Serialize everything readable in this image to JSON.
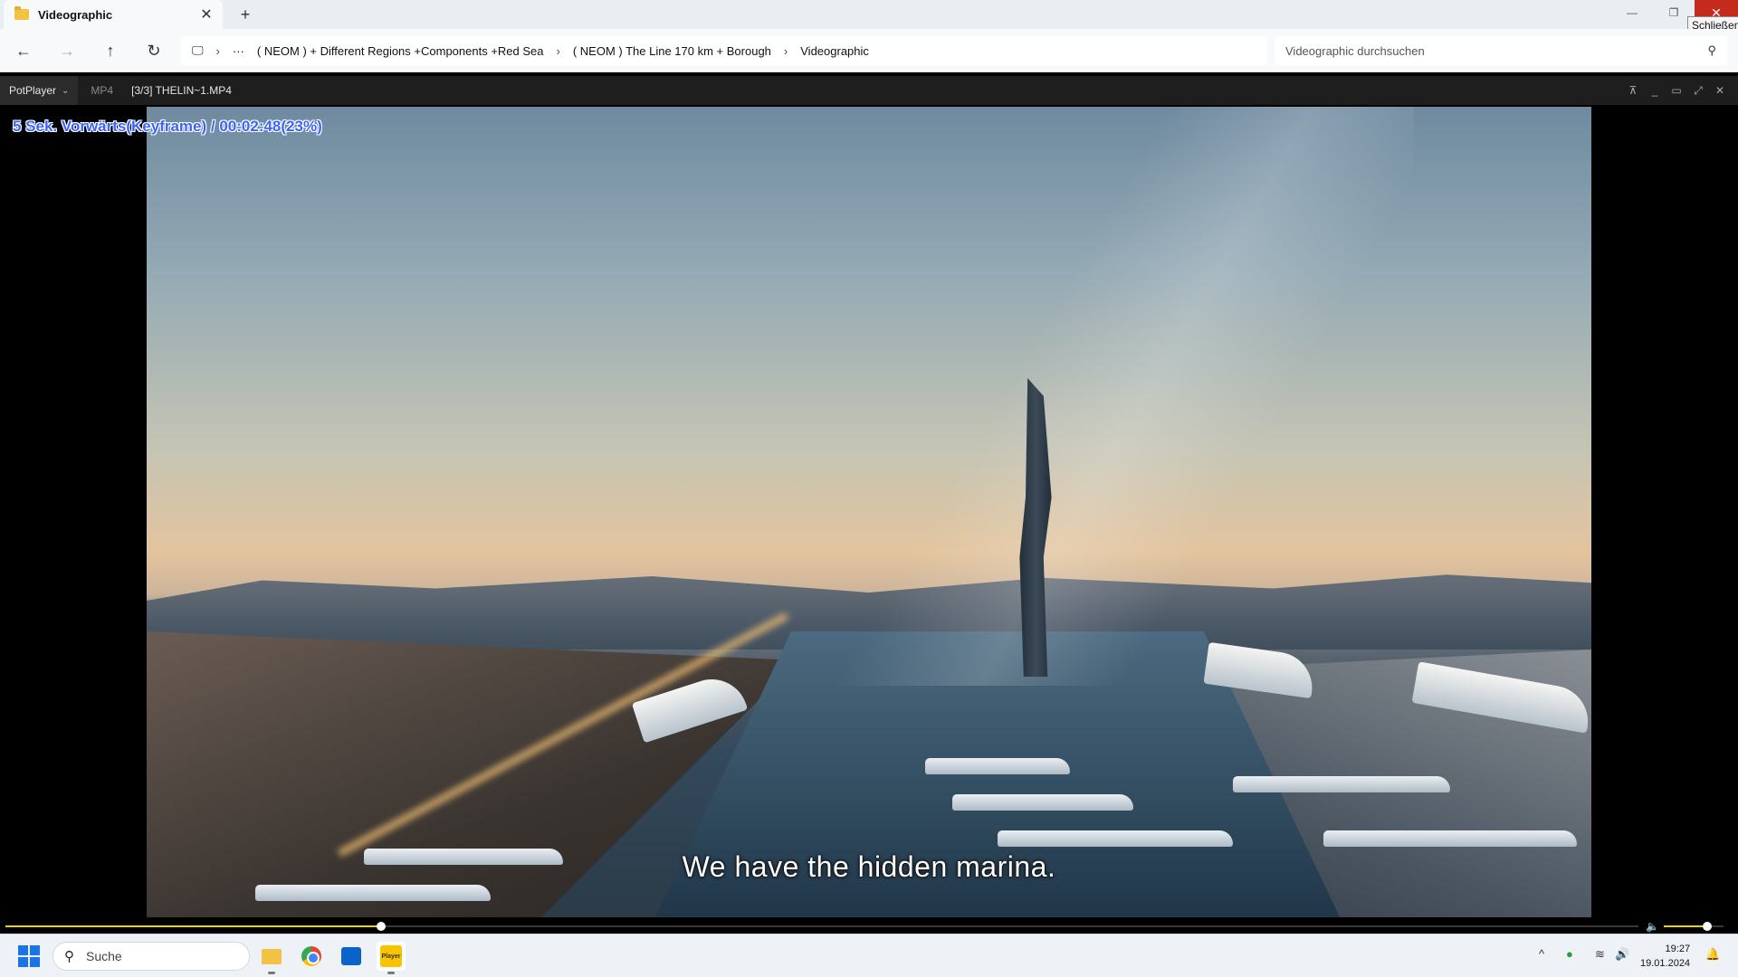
{
  "explorer": {
    "tab_title": "Videographic",
    "tab_close": "✕",
    "new_tab": "+",
    "window_min": "—",
    "window_restore": "❐",
    "window_close": "✕",
    "close_tooltip": "Schließen",
    "nav": {
      "back": "←",
      "forward": "→",
      "up": "↑",
      "refresh": "↻",
      "monitor": "🖵",
      "chevron": "›",
      "more": "···"
    },
    "breadcrumbs": [
      "( NEOM ) + Different Regions +Components +Red Sea",
      "( NEOM ) The Line 170 km + Borough",
      "Videographic"
    ],
    "search_placeholder": "Videographic durchsuchen",
    "search_icon": "search-icon"
  },
  "player": {
    "menu_label": "PotPlayer",
    "menu_chevron": "⌄",
    "format": "MP4",
    "file": "[3/3] THELIN~1.MP4",
    "controls": {
      "pin": "⊼",
      "minimize": "_",
      "maximize": "▭",
      "fullscreen": "⤢",
      "close": "✕"
    },
    "osd": "5  Sek. Vorwärts(Keyframe) / 00:02:48(23%)",
    "subtitle": "We have the hidden marina.",
    "progress": 0.23,
    "volume": 0.72,
    "volume_icon": "🔈",
    "colors": {
      "accent": "#f3d200",
      "osd": "#3b63ff"
    }
  },
  "taskbar": {
    "search_label": "Suche",
    "search_icon": "🔍",
    "apps": [
      "file-explorer-icon",
      "chrome-icon",
      "microsoft-store-icon",
      "potplayer-icon"
    ],
    "potplayer_label": "Player",
    "tray_chevron": "^",
    "tray_shield": "●",
    "tray_wifi": "≋",
    "tray_speaker": "🔊",
    "time": "19:27",
    "date": "19.01.2024",
    "bell": "🔔"
  }
}
